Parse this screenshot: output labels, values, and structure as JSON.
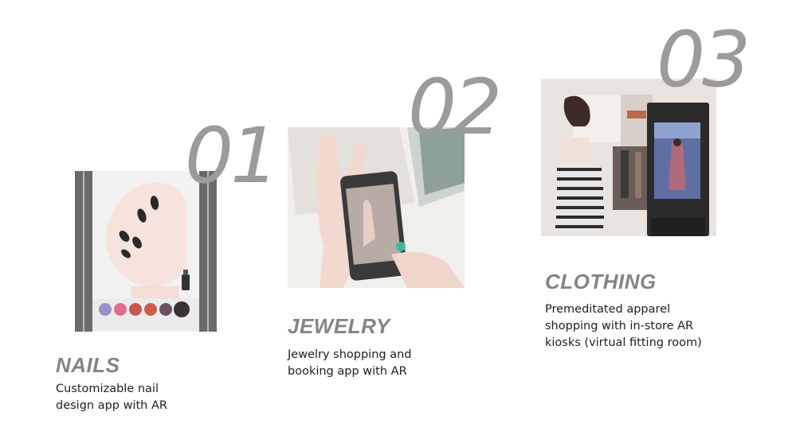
{
  "items": [
    {
      "number": "01",
      "title": "NAILS",
      "description": "Customizable nail\ndesign app with AR"
    },
    {
      "number": "02",
      "title": "JEWELRY",
      "description": "Jewelry shopping and\nbooking app with AR"
    },
    {
      "number": "03",
      "title": "CLOTHING",
      "description": "Premeditated apparel\nshopping with in-store AR\nkiosks (virtual fitting room)"
    }
  ],
  "colors": {
    "number": "#9b9b9b",
    "title": "#858585",
    "text": "#222222"
  }
}
